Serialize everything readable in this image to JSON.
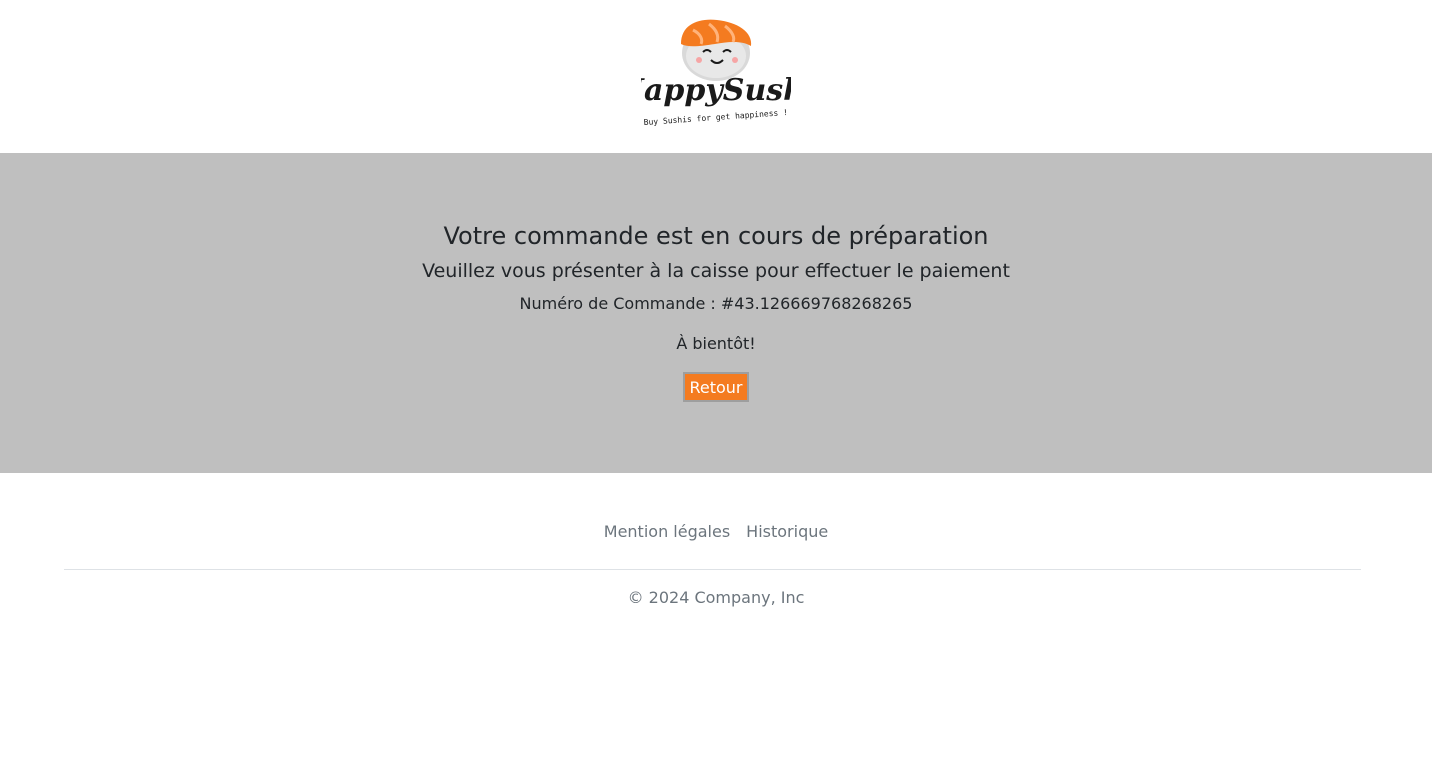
{
  "header": {
    "logo": {
      "name": "HappySushi",
      "tagline": "Buy Sushis for get happiness !",
      "colors": {
        "salmon": "#f47b20",
        "rice": "#d9d9d9",
        "ink": "#1a1a1a"
      }
    }
  },
  "confirmation": {
    "title": "Votre commande est en cours de préparation",
    "subtitle": "Veuillez vous présenter à la caisse pour effectuer le paiement",
    "order_number": "Numéro de Commande : #43.126669768268265",
    "farewell": "À bientôt!",
    "back_button": "Retour",
    "banner_color": "#bfbfbf",
    "button_color": "#f47b20"
  },
  "footer": {
    "links": [
      {
        "label": "Mention légales"
      },
      {
        "label": "Historique"
      }
    ],
    "copyright": "© 2024 Company, Inc"
  }
}
